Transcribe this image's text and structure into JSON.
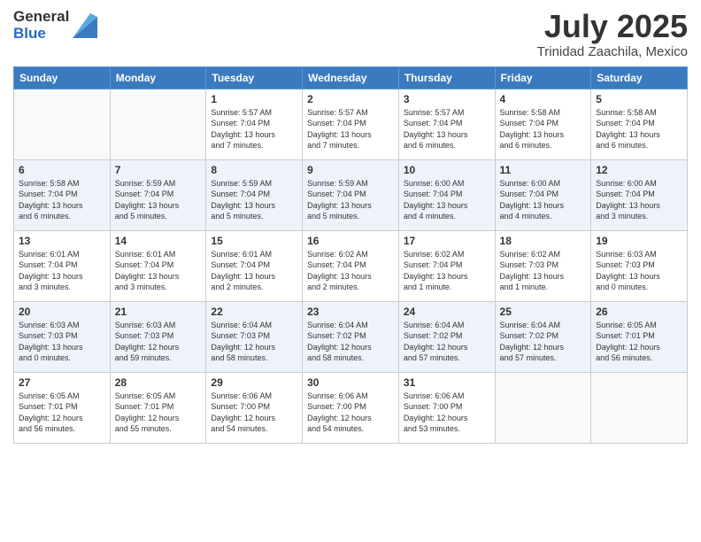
{
  "header": {
    "logo_general": "General",
    "logo_blue": "Blue",
    "month_title": "July 2025",
    "location": "Trinidad Zaachila, Mexico"
  },
  "weekdays": [
    "Sunday",
    "Monday",
    "Tuesday",
    "Wednesday",
    "Thursday",
    "Friday",
    "Saturday"
  ],
  "weeks": [
    [
      {
        "day": "",
        "info": ""
      },
      {
        "day": "",
        "info": ""
      },
      {
        "day": "1",
        "info": "Sunrise: 5:57 AM\nSunset: 7:04 PM\nDaylight: 13 hours\nand 7 minutes."
      },
      {
        "day": "2",
        "info": "Sunrise: 5:57 AM\nSunset: 7:04 PM\nDaylight: 13 hours\nand 7 minutes."
      },
      {
        "day": "3",
        "info": "Sunrise: 5:57 AM\nSunset: 7:04 PM\nDaylight: 13 hours\nand 6 minutes."
      },
      {
        "day": "4",
        "info": "Sunrise: 5:58 AM\nSunset: 7:04 PM\nDaylight: 13 hours\nand 6 minutes."
      },
      {
        "day": "5",
        "info": "Sunrise: 5:58 AM\nSunset: 7:04 PM\nDaylight: 13 hours\nand 6 minutes."
      }
    ],
    [
      {
        "day": "6",
        "info": "Sunrise: 5:58 AM\nSunset: 7:04 PM\nDaylight: 13 hours\nand 6 minutes."
      },
      {
        "day": "7",
        "info": "Sunrise: 5:59 AM\nSunset: 7:04 PM\nDaylight: 13 hours\nand 5 minutes."
      },
      {
        "day": "8",
        "info": "Sunrise: 5:59 AM\nSunset: 7:04 PM\nDaylight: 13 hours\nand 5 minutes."
      },
      {
        "day": "9",
        "info": "Sunrise: 5:59 AM\nSunset: 7:04 PM\nDaylight: 13 hours\nand 5 minutes."
      },
      {
        "day": "10",
        "info": "Sunrise: 6:00 AM\nSunset: 7:04 PM\nDaylight: 13 hours\nand 4 minutes."
      },
      {
        "day": "11",
        "info": "Sunrise: 6:00 AM\nSunset: 7:04 PM\nDaylight: 13 hours\nand 4 minutes."
      },
      {
        "day": "12",
        "info": "Sunrise: 6:00 AM\nSunset: 7:04 PM\nDaylight: 13 hours\nand 3 minutes."
      }
    ],
    [
      {
        "day": "13",
        "info": "Sunrise: 6:01 AM\nSunset: 7:04 PM\nDaylight: 13 hours\nand 3 minutes."
      },
      {
        "day": "14",
        "info": "Sunrise: 6:01 AM\nSunset: 7:04 PM\nDaylight: 13 hours\nand 3 minutes."
      },
      {
        "day": "15",
        "info": "Sunrise: 6:01 AM\nSunset: 7:04 PM\nDaylight: 13 hours\nand 2 minutes."
      },
      {
        "day": "16",
        "info": "Sunrise: 6:02 AM\nSunset: 7:04 PM\nDaylight: 13 hours\nand 2 minutes."
      },
      {
        "day": "17",
        "info": "Sunrise: 6:02 AM\nSunset: 7:04 PM\nDaylight: 13 hours\nand 1 minute."
      },
      {
        "day": "18",
        "info": "Sunrise: 6:02 AM\nSunset: 7:03 PM\nDaylight: 13 hours\nand 1 minute."
      },
      {
        "day": "19",
        "info": "Sunrise: 6:03 AM\nSunset: 7:03 PM\nDaylight: 13 hours\nand 0 minutes."
      }
    ],
    [
      {
        "day": "20",
        "info": "Sunrise: 6:03 AM\nSunset: 7:03 PM\nDaylight: 13 hours\nand 0 minutes."
      },
      {
        "day": "21",
        "info": "Sunrise: 6:03 AM\nSunset: 7:03 PM\nDaylight: 12 hours\nand 59 minutes."
      },
      {
        "day": "22",
        "info": "Sunrise: 6:04 AM\nSunset: 7:03 PM\nDaylight: 12 hours\nand 58 minutes."
      },
      {
        "day": "23",
        "info": "Sunrise: 6:04 AM\nSunset: 7:02 PM\nDaylight: 12 hours\nand 58 minutes."
      },
      {
        "day": "24",
        "info": "Sunrise: 6:04 AM\nSunset: 7:02 PM\nDaylight: 12 hours\nand 57 minutes."
      },
      {
        "day": "25",
        "info": "Sunrise: 6:04 AM\nSunset: 7:02 PM\nDaylight: 12 hours\nand 57 minutes."
      },
      {
        "day": "26",
        "info": "Sunrise: 6:05 AM\nSunset: 7:01 PM\nDaylight: 12 hours\nand 56 minutes."
      }
    ],
    [
      {
        "day": "27",
        "info": "Sunrise: 6:05 AM\nSunset: 7:01 PM\nDaylight: 12 hours\nand 56 minutes."
      },
      {
        "day": "28",
        "info": "Sunrise: 6:05 AM\nSunset: 7:01 PM\nDaylight: 12 hours\nand 55 minutes."
      },
      {
        "day": "29",
        "info": "Sunrise: 6:06 AM\nSunset: 7:00 PM\nDaylight: 12 hours\nand 54 minutes."
      },
      {
        "day": "30",
        "info": "Sunrise: 6:06 AM\nSunset: 7:00 PM\nDaylight: 12 hours\nand 54 minutes."
      },
      {
        "day": "31",
        "info": "Sunrise: 6:06 AM\nSunset: 7:00 PM\nDaylight: 12 hours\nand 53 minutes."
      },
      {
        "day": "",
        "info": ""
      },
      {
        "day": "",
        "info": ""
      }
    ]
  ]
}
